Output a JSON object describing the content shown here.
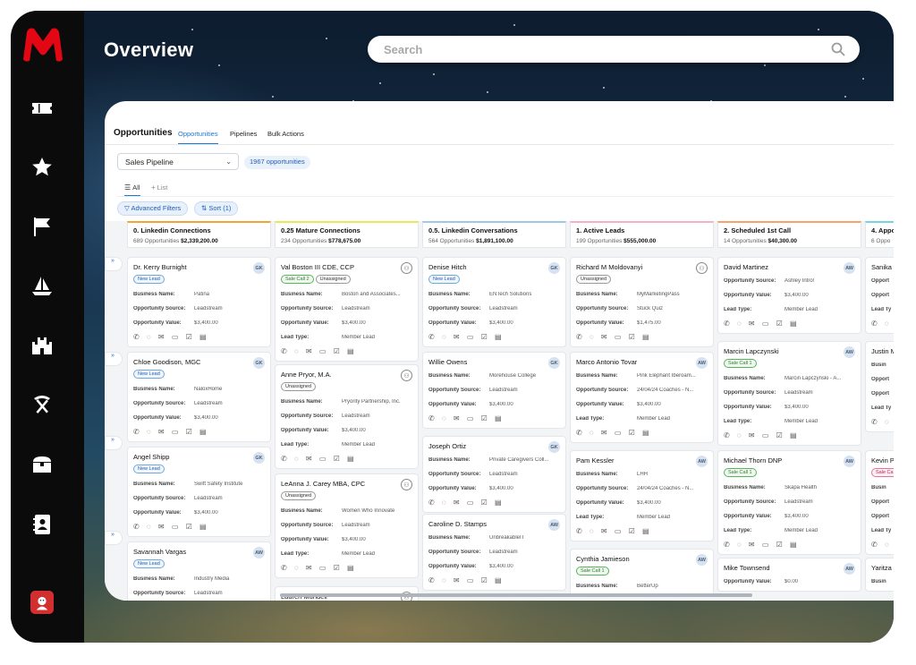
{
  "app": {
    "title": "Overview",
    "brand_color": "#e30613"
  },
  "search": {
    "placeholder": "Search"
  },
  "sidebar": {
    "icons": [
      "logo-icon",
      "ticket-icon",
      "star-icon",
      "flag-icon",
      "sailboat-icon",
      "castle-icon",
      "pickaxe-icon",
      "treasure-chest-icon",
      "contact-book-icon",
      "user-avatar-icon"
    ]
  },
  "panel": {
    "title": "Opportunities",
    "tabs": [
      "Opportunities",
      "Pipelines",
      "Bulk Actions"
    ],
    "pipeline": "Sales Pipeline",
    "count": "1967 opportunities",
    "view_all": "All",
    "view_list": "List",
    "filter_btn": "Advanced Filters",
    "sort_btn": "Sort (1)"
  },
  "columns": [
    {
      "name": "0. Linkedin Connections",
      "count": "689 Opportunities",
      "total": "$2,339,200.00",
      "color": "#f0a43a",
      "cards": [
        {
          "name": "Dr. Kerry Burnight",
          "badge": "GK",
          "tags": [
            {
              "t": "New Lead",
              "c": "new"
            }
          ],
          "fields": [
            [
              "Business Name:",
              "Patina"
            ],
            [
              "Opportunity Source:",
              "Leadstream"
            ],
            [
              "Opportunity Value:",
              "$3,400.00"
            ]
          ]
        },
        {
          "name": "Chloe Goodison, MGC",
          "badge": "GK",
          "tags": [
            {
              "t": "New Lead",
              "c": "new"
            }
          ],
          "fields": [
            [
              "Business Name:",
              "NaloxHome"
            ],
            [
              "Opportunity Source:",
              "Leadstream"
            ],
            [
              "Opportunity Value:",
              "$3,400.00"
            ]
          ]
        },
        {
          "name": "Angel Shipp",
          "badge": "GK",
          "tags": [
            {
              "t": "New Lead",
              "c": "new"
            }
          ],
          "fields": [
            [
              "Business Name:",
              "Swift Safety Institute"
            ],
            [
              "Opportunity Source:",
              "Leadstream"
            ],
            [
              "Opportunity Value:",
              "$3,400.00"
            ]
          ]
        },
        {
          "name": "Savannah Vargas",
          "badge": "AW",
          "tags": [
            {
              "t": "New Lead",
              "c": "new"
            }
          ],
          "fields": [
            [
              "Business Name:",
              "Industry Media"
            ],
            [
              "Opportunity Source:",
              "Leadstream"
            ]
          ]
        }
      ]
    },
    {
      "name": "0.25 Mature Connections",
      "count": "234 Opportunities",
      "total": "$778,675.00",
      "color": "#e6e85a",
      "cards": [
        {
          "name": "Val Boston III CDE, CCP",
          "badge": "",
          "tags": [
            {
              "t": "Sale Call 2",
              "c": "sale"
            },
            {
              "t": "Unassigned",
              "c": "un"
            }
          ],
          "fields": [
            [
              "Business Name:",
              "Boston and Associates..."
            ],
            [
              "Opportunity Source:",
              "Leadstream"
            ],
            [
              "Opportunity Value:",
              "$3,400.00"
            ],
            [
              "Lead Type:",
              "Member Lead"
            ]
          ]
        },
        {
          "name": "Anne Pryor, M.A.",
          "badge": "",
          "tags": [
            {
              "t": "Unassigned",
              "c": "un"
            }
          ],
          "fields": [
            [
              "Business Name:",
              "Pryority Partnership, Inc."
            ],
            [
              "Opportunity Source:",
              "Leadstream"
            ],
            [
              "Opportunity Value:",
              "$3,400.00"
            ],
            [
              "Lead Type:",
              "Member Lead"
            ]
          ]
        },
        {
          "name": "LeAnna J. Carey MBA, CPC",
          "badge": "",
          "tags": [
            {
              "t": "Unassigned",
              "c": "un"
            }
          ],
          "fields": [
            [
              "Business Name:",
              "Women Who Innovate"
            ],
            [
              "Opportunity Source:",
              "Leadstream"
            ],
            [
              "Opportunity Value:",
              "$3,400.00"
            ],
            [
              "Lead Type:",
              "Member Lead"
            ]
          ]
        },
        {
          "name": "Lauren Mundell",
          "badge": "",
          "tags": [],
          "fields": []
        }
      ]
    },
    {
      "name": "0.5. Linkedin Conversations",
      "count": "564 Opportunities",
      "total": "$1,891,100.00",
      "color": "#9ec9e8",
      "cards": [
        {
          "name": "Denise Hitch",
          "badge": "GK",
          "tags": [
            {
              "t": "New Lead",
              "c": "new"
            }
          ],
          "fields": [
            [
              "Business Name:",
              "ENTech Solutions"
            ],
            [
              "Opportunity Source:",
              "Leadstream"
            ],
            [
              "Opportunity Value:",
              "$3,400.00"
            ]
          ]
        },
        {
          "name": "Willie Owens",
          "badge": "GK",
          "tags": [],
          "fields": [
            [
              "Business Name:",
              "Morehouse College"
            ],
            [
              "Opportunity Source:",
              "Leadstream"
            ],
            [
              "Opportunity Value:",
              "$3,400.00"
            ]
          ]
        },
        {
          "name": "Joseph Ortiz",
          "badge": "GK",
          "tags": [],
          "fields": [
            [
              "Business Name:",
              "Private Caregivers Coll..."
            ],
            [
              "Opportunity Source:",
              "Leadstream"
            ],
            [
              "Opportunity Value:",
              "$3,400.00"
            ]
          ]
        },
        {
          "name": "Caroline D. Stamps",
          "badge": "AW",
          "tags": [],
          "fields": [
            [
              "Business Name:",
              "UnbreakableIT"
            ],
            [
              "Opportunity Source:",
              "Leadstream"
            ],
            [
              "Opportunity Value:",
              "$3,400.00"
            ]
          ]
        }
      ]
    },
    {
      "name": "1. Active Leads",
      "count": "199 Opportunities",
      "total": "$555,000.00",
      "color": "#f3b0c8",
      "cards": [
        {
          "name": "Richard M Moldovanyi",
          "badge": "",
          "tags": [
            {
              "t": "Unassigned",
              "c": "un"
            }
          ],
          "fields": [
            [
              "Business Name:",
              "MyMarketingPass"
            ],
            [
              "Opportunity Source:",
              "Stuck Quiz"
            ],
            [
              "Opportunity Value:",
              "$1,475.00"
            ]
          ]
        },
        {
          "name": "Marco Antonio Tovar",
          "badge": "AW",
          "tags": [],
          "fields": [
            [
              "Business Name:",
              "Pink Elephant Iberoam..."
            ],
            [
              "Opportunity Source:",
              "24/04/24 Coaches - N..."
            ],
            [
              "Opportunity Value:",
              "$3,400.00"
            ],
            [
              "Lead Type:",
              "Member Lead"
            ]
          ]
        },
        {
          "name": "Pam Kessler",
          "badge": "AW",
          "tags": [],
          "fields": [
            [
              "Business Name:",
              "LHH"
            ],
            [
              "Opportunity Source:",
              "24/04/24 Coaches - N..."
            ],
            [
              "Opportunity Value:",
              "$3,400.00"
            ],
            [
              "Lead Type:",
              "Member Lead"
            ]
          ]
        },
        {
          "name": "Cynthia Jamieson",
          "badge": "AW",
          "tags": [
            {
              "t": "Sale Call 1",
              "c": "sale"
            }
          ],
          "fields": [
            [
              "Business Name:",
              "BetterUp"
            ]
          ]
        }
      ]
    },
    {
      "name": "2. Scheduled 1st Call",
      "count": "14 Opportunities",
      "total": "$40,300.00",
      "color": "#f4a46a",
      "cards": [
        {
          "name": "David Martinez",
          "badge": "AW",
          "tags": [],
          "fields": [
            [
              "Opportunity Source:",
              "Ashley Intro!"
            ],
            [
              "Opportunity Value:",
              "$3,400.00"
            ],
            [
              "Lead Type:",
              "Member Lead"
            ]
          ]
        },
        {
          "name": "Marcin Lapczynski",
          "badge": "AW",
          "tags": [
            {
              "t": "Sale Call 1",
              "c": "sale"
            }
          ],
          "fields": [
            [
              "Business Name:",
              "Marcin Lapczynski - A..."
            ],
            [
              "Opportunity Source:",
              "Leadstream"
            ],
            [
              "Opportunity Value:",
              "$3,400.00"
            ],
            [
              "Lead Type:",
              "Member Lead"
            ]
          ]
        },
        {
          "name": "Michael Thorn DNP",
          "badge": "AW",
          "tags": [
            {
              "t": "Sale Call 1",
              "c": "sale"
            }
          ],
          "fields": [
            [
              "Business Name:",
              "Skapa Health"
            ],
            [
              "Opportunity Source:",
              "Leadstream"
            ],
            [
              "Opportunity Value:",
              "$3,400.00"
            ],
            [
              "Lead Type:",
              "Member Lead"
            ]
          ]
        },
        {
          "name": "Mike Townsend",
          "badge": "AW",
          "tags": [],
          "fields": [
            [
              "Opportunity Value:",
              "$0.00"
            ]
          ]
        }
      ]
    },
    {
      "name": "4. Appo",
      "count": "6 Oppo",
      "total": "",
      "color": "#7ad1e0",
      "cards": [
        {
          "name": "Sanika",
          "badge": "",
          "tags": [],
          "fields": [
            [
              "Opport",
              ""
            ],
            [
              "Opport",
              ""
            ],
            [
              "Lead Ty",
              ""
            ]
          ]
        },
        {
          "name": "Justin M",
          "badge": "",
          "tags": [],
          "fields": [
            [
              "Busin",
              ""
            ],
            [
              "Opport",
              ""
            ],
            [
              "Opport",
              ""
            ],
            [
              "Lead Ty",
              ""
            ]
          ]
        },
        {
          "name": "Kevin P",
          "badge": "",
          "tags": [
            {
              "t": "Sale Ca",
              "c": "salepink"
            }
          ],
          "fields": [
            [
              "Busin",
              ""
            ],
            [
              "Opport",
              ""
            ],
            [
              "Opport",
              ""
            ],
            [
              "Lead Ty",
              ""
            ]
          ]
        },
        {
          "name": "Yaritza",
          "badge": "",
          "tags": [],
          "fields": [
            [
              "Busin",
              ""
            ]
          ]
        }
      ]
    }
  ],
  "left_tabs": [
    "»",
    "»",
    "»",
    "»"
  ]
}
